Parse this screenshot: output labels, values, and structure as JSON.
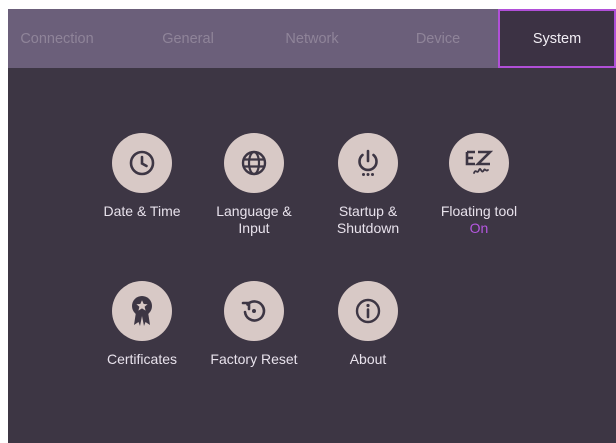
{
  "tabs": [
    {
      "label": "Connection",
      "active": false
    },
    {
      "label": "General",
      "active": false
    },
    {
      "label": "Network",
      "active": false
    },
    {
      "label": "Device",
      "active": false
    },
    {
      "label": "System",
      "active": true
    }
  ],
  "tiles": [
    {
      "label": "Date & Time",
      "icon": "clock-icon"
    },
    {
      "label": "Language &\nInput",
      "icon": "globe-icon"
    },
    {
      "label": "Startup &\nShutdown",
      "icon": "power-icon"
    },
    {
      "label": "Floating tool",
      "status": "On",
      "icon": "ez-write-icon"
    },
    {
      "label": "Certificates",
      "icon": "award-ribbon-icon"
    },
    {
      "label": "Factory Reset",
      "icon": "reset-icon"
    },
    {
      "label": "About",
      "icon": "info-icon"
    }
  ],
  "colors": {
    "background": "#3d3644",
    "tabbar": "#6b5f7a",
    "active_border": "#b14fd8",
    "icon_circle": "#d8c9c6",
    "status_accent": "#b557e0"
  }
}
